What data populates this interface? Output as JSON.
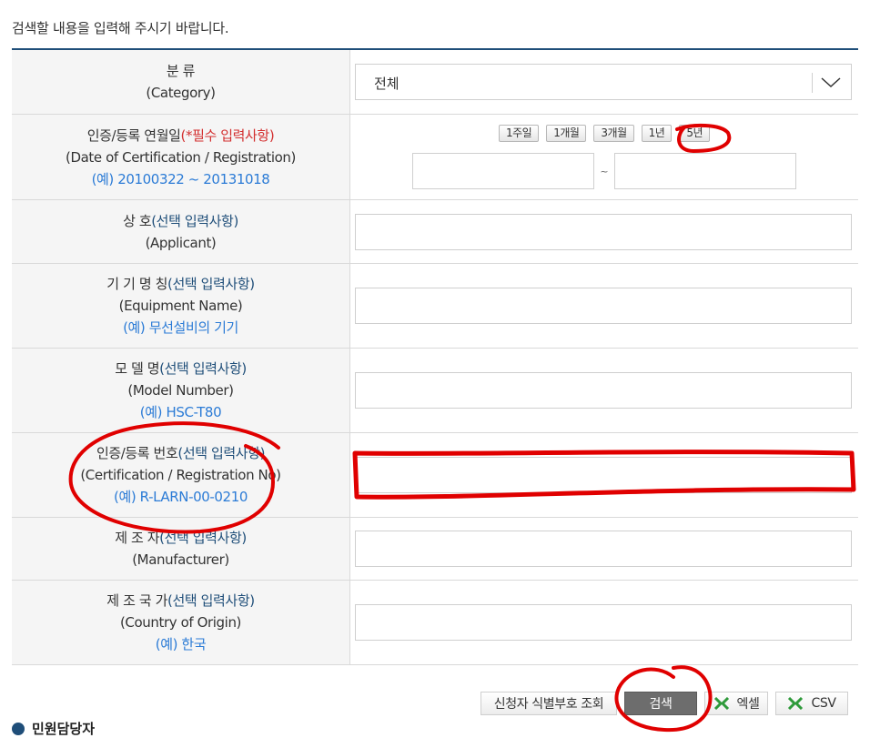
{
  "intro_text": "검색할 내용을 입력해 주시기 바랍니다.",
  "rows": {
    "category": {
      "label_ko": "분 류",
      "label_en": "(Category)",
      "select_value": "전체"
    },
    "date": {
      "label_ko": "인증/등록 연월일",
      "label_req": "(*필수 입력사항)",
      "label_en": "(Date of Certification / Registration)",
      "example": "(예) 20100322 ~ 20131018",
      "period_buttons": [
        "1주일",
        "1개월",
        "3개월",
        "1년",
        "5년"
      ],
      "range_sep": "~"
    },
    "applicant": {
      "label_ko": "상 호",
      "label_opt": "(선택 입력사항)",
      "label_en": "(Applicant)"
    },
    "equipment": {
      "label_ko": "기 기 명 칭",
      "label_opt": "(선택 입력사항)",
      "label_en": "(Equipment Name)",
      "example": "(예) 무선설비의 기기"
    },
    "model": {
      "label_ko": "모 델 명",
      "label_opt": "(선택 입력사항)",
      "label_en": "(Model Number)",
      "example": "(예) HSC-T80"
    },
    "certno": {
      "label_ko": "인증/등록 번호",
      "label_opt": "(선택 입력사항)",
      "label_en": "(Certification / Registration No)",
      "example": "(예) R-LARN-00-0210"
    },
    "manufacturer": {
      "label_ko": "제 조 자",
      "label_opt": "(선택 입력사항)",
      "label_en": "(Manufacturer)"
    },
    "country": {
      "label_ko": "제 조 국 가",
      "label_opt": "(선택 입력사항)",
      "label_en": "(Country of Origin)",
      "example": "(예) 한국"
    }
  },
  "actions": {
    "applicant_id_lookup": "신청자 식별부호 조회",
    "search": "검색",
    "excel": "엑셀",
    "csv": "CSV"
  },
  "bottom_title": "민원담당자",
  "colors": {
    "header_border": "#1f4e79",
    "optional_label": "#1f4e79",
    "required_label": "#d32f2f",
    "example_text": "#2b7bd6",
    "annotation_red": "#e00000",
    "excel_green": "#2e9a3a"
  },
  "icons": {
    "chevron": "chevron-down-icon",
    "excel": "excel-x-icon",
    "csv": "csv-x-icon"
  }
}
